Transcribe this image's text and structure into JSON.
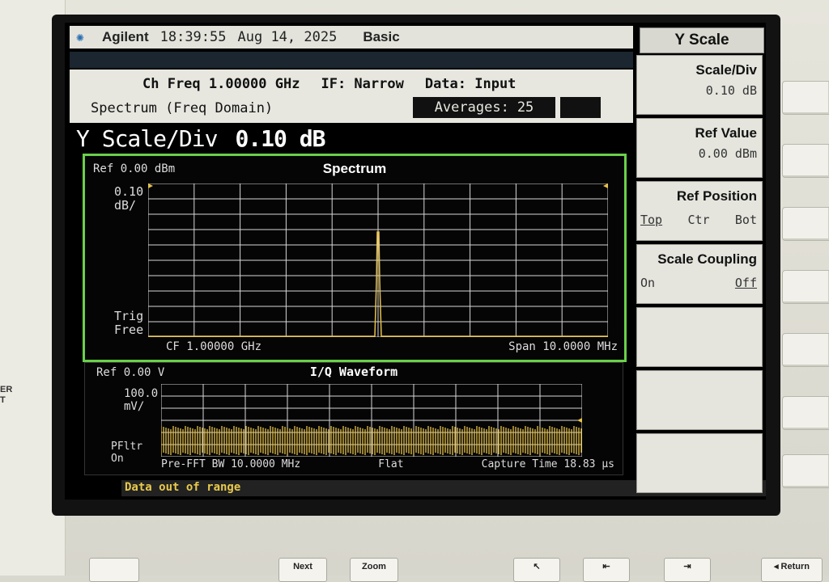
{
  "titlebar": {
    "brand": "Agilent",
    "time": "18:39:55",
    "date": "Aug 14, 2025",
    "mode": "Basic"
  },
  "header": {
    "ch_freq": "Ch Freq 1.00000 GHz",
    "if": "IF: Narrow",
    "data": "Data: Input",
    "view": "Spectrum (Freq Domain)",
    "averages_label": "Averages:",
    "averages_value": "25"
  },
  "active_function": {
    "label": "Y Scale/Div",
    "value": "0.10 dB"
  },
  "spectrum": {
    "title": "Spectrum",
    "ref": "Ref 0.00 dBm",
    "scale_line1": "0.10",
    "scale_line2": "dB/",
    "trig_line1": "Trig",
    "trig_line2": "Free",
    "cf": "CF 1.00000 GHz",
    "span": "Span  10.0000 MHz",
    "trace_color": "#e8c24a"
  },
  "iq": {
    "title": "I/Q Waveform",
    "ref": "Ref 0.00  V",
    "scale_line1": "100.0",
    "scale_line2": "mV/",
    "pfltr_line1": "PFltr",
    "pfltr_line2": "On",
    "bw": "Pre-FFT BW 10.0000 MHz",
    "flat": "Flat",
    "capture": "Capture Time 18.83 μs"
  },
  "status": {
    "message": "Data out of range"
  },
  "menu": {
    "title": "Y Scale",
    "softkeys": [
      {
        "label": "Scale/Div",
        "value": "0.10 dB"
      },
      {
        "label": "Ref Value",
        "value": "0.00 dBm"
      },
      {
        "label": "Ref Position",
        "opt1": "Top",
        "opt2": "Ctr",
        "opt3": "Bot"
      },
      {
        "label": "Scale Coupling",
        "opt1": "On",
        "opt2": "Off"
      }
    ]
  },
  "hardware": {
    "left_text_1": "ER",
    "left_text_2": "T",
    "next": "Next",
    "zoom": "Zoom",
    "return": "◂ Return"
  },
  "colors": {
    "grid": "#d8d8d8",
    "trace": "#e8c24a",
    "active_border": "#6ad04a",
    "status_text": "#e8c94a"
  }
}
